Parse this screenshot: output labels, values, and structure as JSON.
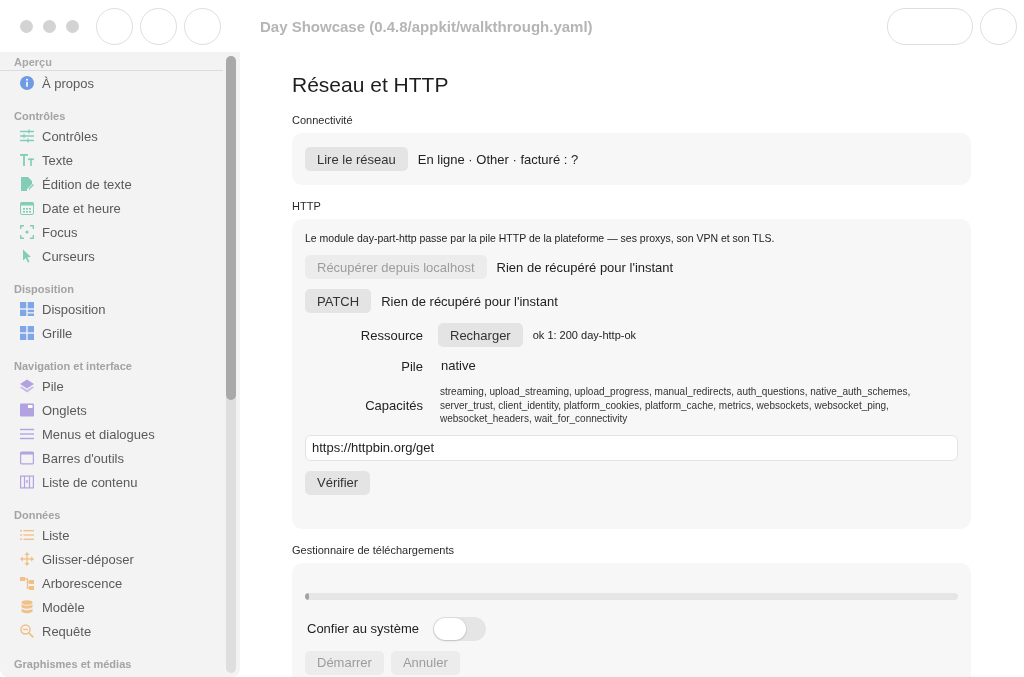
{
  "window": {
    "title": "Day Showcase (0.4.8/appkit/walkthrough.yaml)"
  },
  "sidebar": {
    "sections": [
      {
        "title": "Aperçu",
        "items": [
          {
            "label": "À propos",
            "selected": false
          }
        ]
      },
      {
        "title": "Contrôles",
        "items": [
          {
            "label": "Contrôles",
            "selected": false
          },
          {
            "label": "Texte",
            "selected": false
          },
          {
            "label": "Édition de texte",
            "selected": false
          },
          {
            "label": "Date et heure",
            "selected": false
          },
          {
            "label": "Focus",
            "selected": false
          },
          {
            "label": "Curseurs",
            "selected": false
          }
        ]
      },
      {
        "title": "Disposition",
        "items": [
          {
            "label": "Disposition",
            "selected": false
          },
          {
            "label": "Grille",
            "selected": false
          }
        ]
      },
      {
        "title": "Navigation et interface",
        "items": [
          {
            "label": "Pile",
            "selected": false
          },
          {
            "label": "Onglets",
            "selected": false
          },
          {
            "label": "Menus et dialogues",
            "selected": false
          },
          {
            "label": "Barres d'outils",
            "selected": false
          },
          {
            "label": "Liste de contenu",
            "selected": false
          }
        ]
      },
      {
        "title": "Données",
        "items": [
          {
            "label": "Liste",
            "selected": false
          },
          {
            "label": "Glisser-déposer",
            "selected": false
          },
          {
            "label": "Arborescence",
            "selected": false
          },
          {
            "label": "Modèle",
            "selected": false
          },
          {
            "label": "Requête",
            "selected": false
          }
        ]
      },
      {
        "title": "Graphismes et médias"
      }
    ]
  },
  "page": {
    "title": "Réseau et HTTP"
  },
  "connectivity": {
    "label": "Connectivité",
    "button": {
      "label": "Lire le réseau",
      "disabled": false
    },
    "status": "En ligne · Other · facturé : ?"
  },
  "http": {
    "label": "HTTP",
    "note": "Le module day-part-http passe par la pile HTTP de la plateforme — ses proxys, son VPN et son TLS.",
    "fetch_rows": [
      {
        "button": {
          "label": "Récupérer depuis localhost",
          "disabled": true
        },
        "result": "Rien de récupéré pour l'instant"
      },
      {
        "button": {
          "label": "PATCH",
          "disabled": false
        },
        "result": "Rien de récupéré pour l'instant"
      }
    ],
    "details": [
      {
        "kind": "button",
        "label": "Ressource",
        "button": {
          "label": "Recharger",
          "disabled": false
        },
        "value": "ok 1: 200 day-http-ok"
      },
      {
        "kind": "text",
        "label": "Pile",
        "value": "native"
      },
      {
        "kind": "list",
        "label": "Capacités",
        "value": "streaming, upload_streaming, upload_progress, manual_redirects, auth_questions, native_auth_schemes, server_trust, client_identity, platform_cookies, platform_cache, metrics, websockets, websocket_ping, websocket_headers, wait_for_connectivity"
      }
    ],
    "url_field": {
      "value": "https://httpbin.org/get"
    },
    "verify_button": {
      "label": "Vérifier",
      "disabled": false
    }
  },
  "downloads": {
    "label": "Gestionnaire de téléchargements",
    "progress": {
      "level": 0.006
    },
    "toggle": {
      "label": "Confier au système",
      "on": false
    },
    "buttons": [
      {
        "label": "Démarrer",
        "disabled": true
      },
      {
        "label": "Annuler",
        "disabled": true
      }
    ]
  }
}
